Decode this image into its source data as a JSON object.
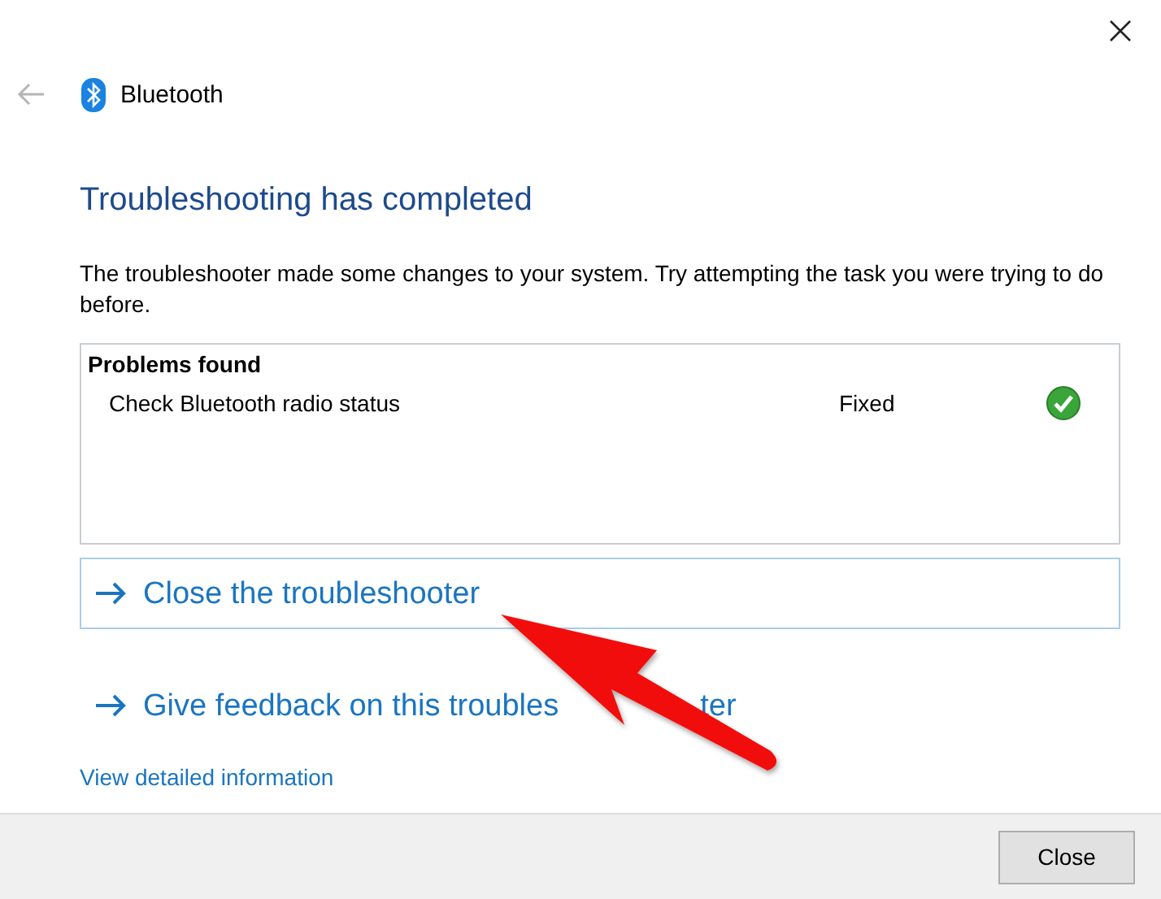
{
  "header": {
    "title": "Bluetooth"
  },
  "heading": "Troubleshooting has completed",
  "message": "The troubleshooter made some changes to your system. Try attempting the task you were trying to do before.",
  "problems": {
    "title": "Problems found",
    "items": [
      {
        "name": "Check Bluetooth radio status",
        "status": "Fixed",
        "fixed": true
      }
    ]
  },
  "actions": [
    {
      "label": "Close the troubleshooter",
      "selected": true
    },
    {
      "label": "Give feedback on this troubles",
      "label_after_arrow": "ter",
      "selected": false
    }
  ],
  "detail_link": "View detailed information",
  "footer_buttons": [
    "Close"
  ]
}
